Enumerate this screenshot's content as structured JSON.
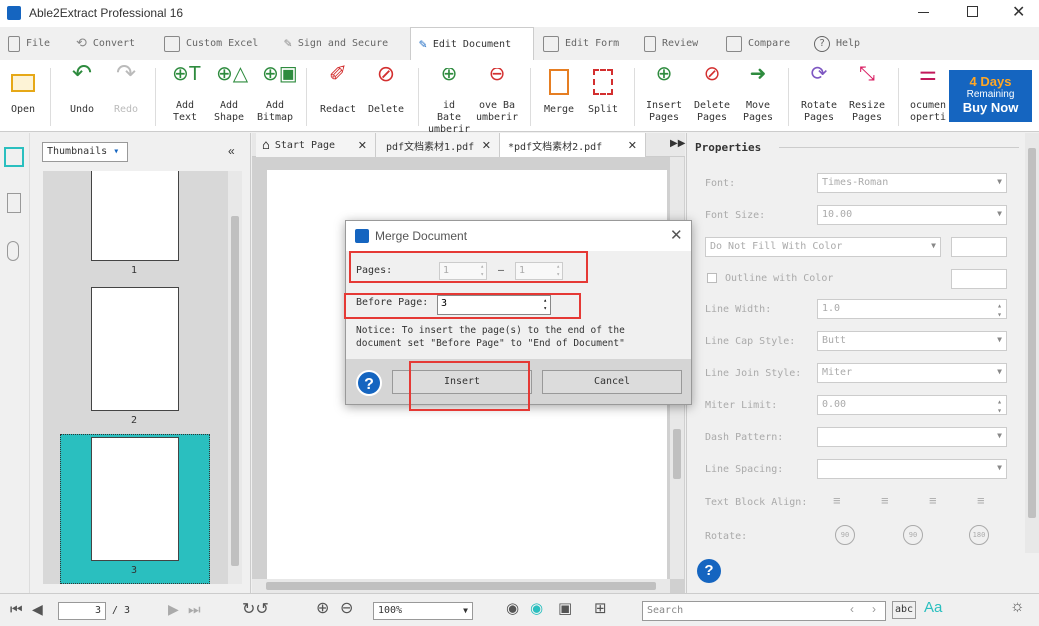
{
  "window": {
    "title": "Able2Extract Professional 16"
  },
  "menu": {
    "file": "File",
    "convert": "Convert",
    "custom_excel": "Custom Excel",
    "sign_secure": "Sign and Secure",
    "edit_document": "Edit Document",
    "edit_form": "Edit Form",
    "review": "Review",
    "compare": "Compare",
    "help": "Help"
  },
  "ribbon": {
    "open": "Open",
    "undo": "Undo",
    "redo": "Redo",
    "add_text": [
      "Add",
      "Text"
    ],
    "add_shape": [
      "Add",
      "Shape"
    ],
    "add_bitmap": [
      "Add",
      "Bitmap"
    ],
    "redact": "Redact",
    "delete": "Delete",
    "add_bates": [
      "id Bate",
      "umberir"
    ],
    "remove_bates": [
      "ove Ba",
      "umberir"
    ],
    "merge": "Merge",
    "split": "Split",
    "insert_pages": [
      "Insert",
      "Pages"
    ],
    "delete_pages": [
      "Delete",
      "Pages"
    ],
    "move_pages": [
      "Move",
      "Pages"
    ],
    "rotate_pages": [
      "Rotate",
      "Pages"
    ],
    "resize_pages": [
      "Resize",
      "Pages"
    ],
    "doc_properties": [
      "ocumen",
      "operti"
    ]
  },
  "trial": {
    "days": "4 Days",
    "remaining": "Remaining",
    "buy": "Buy Now"
  },
  "thumbnails": {
    "dropdown": "Thumbnails",
    "pages": [
      "1",
      "2",
      "3"
    ]
  },
  "tabs": {
    "start": "Start Page",
    "doc1": "pdf文档素材1.pdf",
    "doc2": "*pdf文档素材2.pdf"
  },
  "properties": {
    "title": "Properties",
    "font_label": "Font:",
    "font_value": "Times-Roman",
    "font_size_label": "Font Size:",
    "font_size_value": "10.00",
    "fill": "Do Not Fill With Color",
    "outline": "Outline with Color",
    "line_width_label": "Line Width:",
    "line_width_value": "1.0",
    "cap_label": "Line Cap Style:",
    "cap_value": "Butt",
    "join_label": "Line Join Style:",
    "join_value": "Miter",
    "miter_label": "Miter Limit:",
    "miter_value": "0.00",
    "dash_label": "Dash Pattern:",
    "spacing_label": "Line Spacing:",
    "align_label": "Text Block Align:",
    "rotate_label": "Rotate:",
    "rot": [
      "90",
      "90",
      "180"
    ]
  },
  "dialog": {
    "title": "Merge Document",
    "pages_label": "Pages:",
    "pages_from": "1",
    "pages_dash": "–",
    "pages_to": "1",
    "before_label": "Before Page:",
    "before_value": "3",
    "notice_1": "Notice: To insert the page(s) to the end of the",
    "notice_2": "document set \"Before Page\" to \"End of Document\"",
    "insert": "Insert",
    "cancel": "Cancel",
    "help": "?"
  },
  "status": {
    "page_current": "3",
    "page_sep": "/ 3",
    "zoom": "100%",
    "search_placeholder": "Search"
  },
  "colors": {
    "accent": "#1565c0",
    "highlight": "#2abfbf",
    "annotation": "#e53935"
  }
}
